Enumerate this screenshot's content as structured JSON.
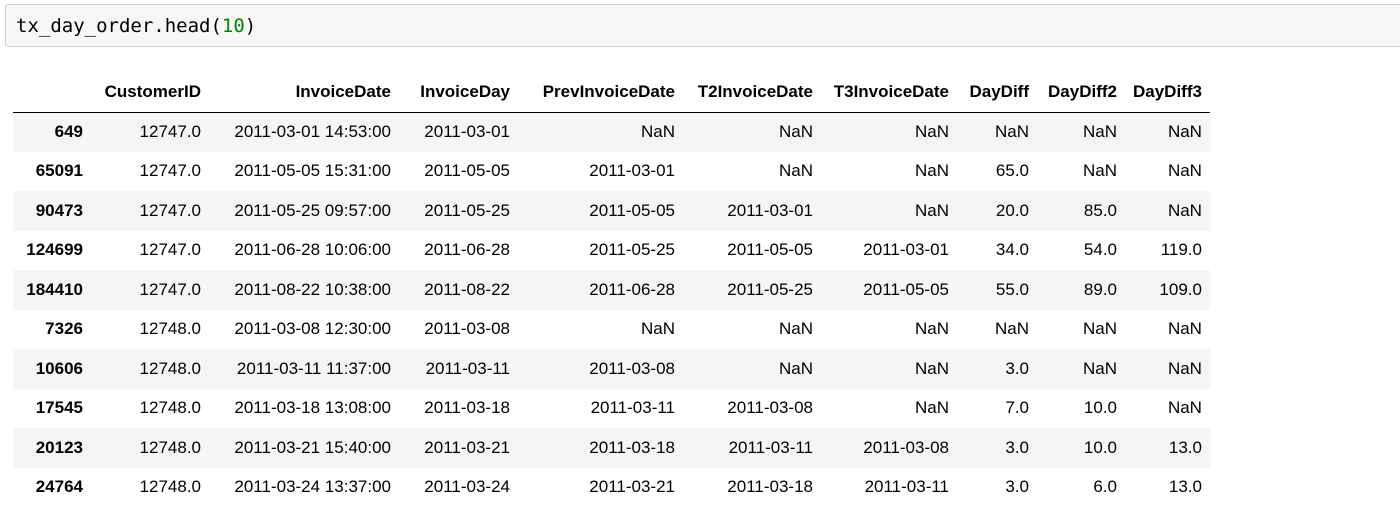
{
  "code_cell": {
    "prefix": "tx_day_order.head(",
    "number": "10",
    "suffix": ")"
  },
  "table": {
    "index_header": "",
    "columns": [
      "CustomerID",
      "InvoiceDate",
      "InvoiceDay",
      "PrevInvoiceDate",
      "T2InvoiceDate",
      "T3InvoiceDate",
      "DayDiff",
      "DayDiff2",
      "DayDiff3"
    ],
    "rows": [
      {
        "index": "649",
        "cells": [
          "12747.0",
          "2011-03-01 14:53:00",
          "2011-03-01",
          "NaN",
          "NaN",
          "NaN",
          "NaN",
          "NaN",
          "NaN"
        ]
      },
      {
        "index": "65091",
        "cells": [
          "12747.0",
          "2011-05-05 15:31:00",
          "2011-05-05",
          "2011-03-01",
          "NaN",
          "NaN",
          "65.0",
          "NaN",
          "NaN"
        ]
      },
      {
        "index": "90473",
        "cells": [
          "12747.0",
          "2011-05-25 09:57:00",
          "2011-05-25",
          "2011-05-05",
          "2011-03-01",
          "NaN",
          "20.0",
          "85.0",
          "NaN"
        ]
      },
      {
        "index": "124699",
        "cells": [
          "12747.0",
          "2011-06-28 10:06:00",
          "2011-06-28",
          "2011-05-25",
          "2011-05-05",
          "2011-03-01",
          "34.0",
          "54.0",
          "119.0"
        ]
      },
      {
        "index": "184410",
        "cells": [
          "12747.0",
          "2011-08-22 10:38:00",
          "2011-08-22",
          "2011-06-28",
          "2011-05-25",
          "2011-05-05",
          "55.0",
          "89.0",
          "109.0"
        ]
      },
      {
        "index": "7326",
        "cells": [
          "12748.0",
          "2011-03-08 12:30:00",
          "2011-03-08",
          "NaN",
          "NaN",
          "NaN",
          "NaN",
          "NaN",
          "NaN"
        ]
      },
      {
        "index": "10606",
        "cells": [
          "12748.0",
          "2011-03-11 11:37:00",
          "2011-03-11",
          "2011-03-08",
          "NaN",
          "NaN",
          "3.0",
          "NaN",
          "NaN"
        ]
      },
      {
        "index": "17545",
        "cells": [
          "12748.0",
          "2011-03-18 13:08:00",
          "2011-03-18",
          "2011-03-11",
          "2011-03-08",
          "NaN",
          "7.0",
          "10.0",
          "NaN"
        ]
      },
      {
        "index": "20123",
        "cells": [
          "12748.0",
          "2011-03-21 15:40:00",
          "2011-03-21",
          "2011-03-18",
          "2011-03-11",
          "2011-03-08",
          "3.0",
          "10.0",
          "13.0"
        ]
      },
      {
        "index": "24764",
        "cells": [
          "12748.0",
          "2011-03-24 13:37:00",
          "2011-03-24",
          "2011-03-21",
          "2011-03-18",
          "2011-03-11",
          "3.0",
          "6.0",
          "13.0"
        ]
      }
    ]
  }
}
